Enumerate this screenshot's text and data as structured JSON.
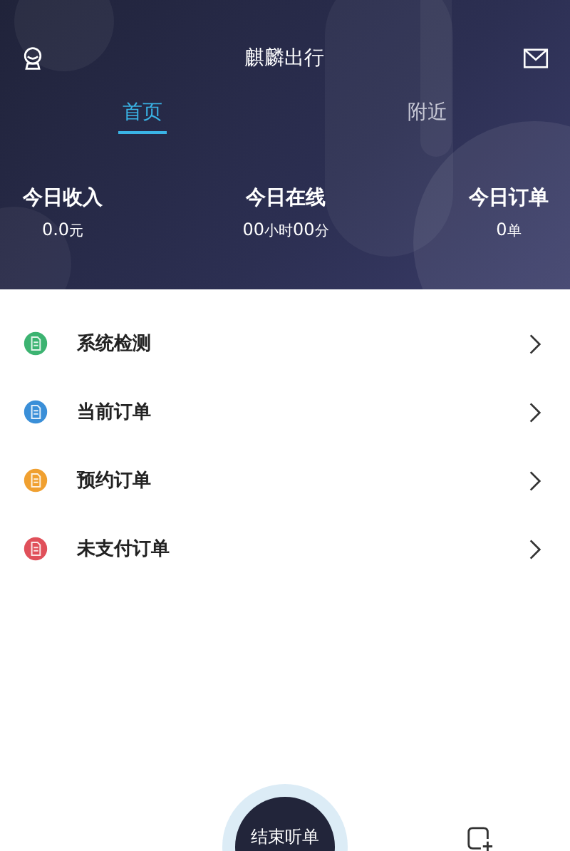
{
  "header": {
    "title": "麒麟出行"
  },
  "tabs": [
    {
      "label": "首页",
      "selected": true
    },
    {
      "label": "附近",
      "selected": false
    }
  ],
  "stats": [
    {
      "label": "今日收入",
      "parts": [
        {
          "text": "0.0",
          "kind": "num"
        },
        {
          "text": "元",
          "kind": "unit"
        }
      ]
    },
    {
      "label": "今日在线",
      "parts": [
        {
          "text": "00",
          "kind": "num"
        },
        {
          "text": "小时",
          "kind": "unit"
        },
        {
          "text": "00",
          "kind": "num"
        },
        {
          "text": "分",
          "kind": "unit"
        }
      ]
    },
    {
      "label": "今日订单",
      "parts": [
        {
          "text": "0",
          "kind": "num"
        },
        {
          "text": "单",
          "kind": "unit"
        }
      ]
    }
  ],
  "menu": [
    {
      "label": "系统检测",
      "color": "#3cb371"
    },
    {
      "label": "当前订单",
      "color": "#3a8fd8"
    },
    {
      "label": "预约订单",
      "color": "#f0a030"
    },
    {
      "label": "未支付订单",
      "color": "#e0505a"
    }
  ],
  "bottom": {
    "button": "结束听单"
  }
}
